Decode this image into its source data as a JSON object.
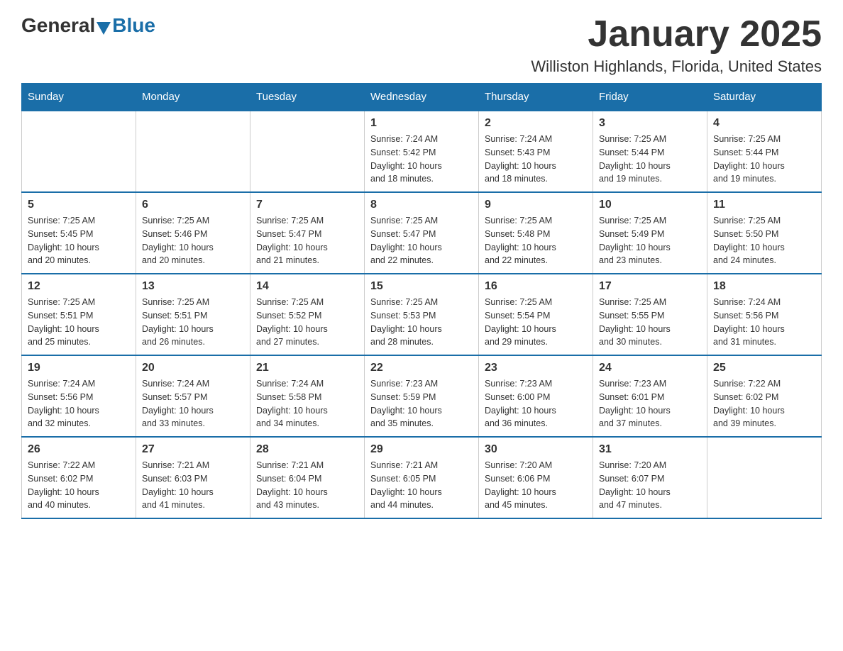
{
  "logo": {
    "general": "General",
    "blue": "Blue"
  },
  "title": "January 2025",
  "location": "Williston Highlands, Florida, United States",
  "days_of_week": [
    "Sunday",
    "Monday",
    "Tuesday",
    "Wednesday",
    "Thursday",
    "Friday",
    "Saturday"
  ],
  "weeks": [
    [
      {
        "day": "",
        "info": ""
      },
      {
        "day": "",
        "info": ""
      },
      {
        "day": "",
        "info": ""
      },
      {
        "day": "1",
        "info": "Sunrise: 7:24 AM\nSunset: 5:42 PM\nDaylight: 10 hours\nand 18 minutes."
      },
      {
        "day": "2",
        "info": "Sunrise: 7:24 AM\nSunset: 5:43 PM\nDaylight: 10 hours\nand 18 minutes."
      },
      {
        "day": "3",
        "info": "Sunrise: 7:25 AM\nSunset: 5:44 PM\nDaylight: 10 hours\nand 19 minutes."
      },
      {
        "day": "4",
        "info": "Sunrise: 7:25 AM\nSunset: 5:44 PM\nDaylight: 10 hours\nand 19 minutes."
      }
    ],
    [
      {
        "day": "5",
        "info": "Sunrise: 7:25 AM\nSunset: 5:45 PM\nDaylight: 10 hours\nand 20 minutes."
      },
      {
        "day": "6",
        "info": "Sunrise: 7:25 AM\nSunset: 5:46 PM\nDaylight: 10 hours\nand 20 minutes."
      },
      {
        "day": "7",
        "info": "Sunrise: 7:25 AM\nSunset: 5:47 PM\nDaylight: 10 hours\nand 21 minutes."
      },
      {
        "day": "8",
        "info": "Sunrise: 7:25 AM\nSunset: 5:47 PM\nDaylight: 10 hours\nand 22 minutes."
      },
      {
        "day": "9",
        "info": "Sunrise: 7:25 AM\nSunset: 5:48 PM\nDaylight: 10 hours\nand 22 minutes."
      },
      {
        "day": "10",
        "info": "Sunrise: 7:25 AM\nSunset: 5:49 PM\nDaylight: 10 hours\nand 23 minutes."
      },
      {
        "day": "11",
        "info": "Sunrise: 7:25 AM\nSunset: 5:50 PM\nDaylight: 10 hours\nand 24 minutes."
      }
    ],
    [
      {
        "day": "12",
        "info": "Sunrise: 7:25 AM\nSunset: 5:51 PM\nDaylight: 10 hours\nand 25 minutes."
      },
      {
        "day": "13",
        "info": "Sunrise: 7:25 AM\nSunset: 5:51 PM\nDaylight: 10 hours\nand 26 minutes."
      },
      {
        "day": "14",
        "info": "Sunrise: 7:25 AM\nSunset: 5:52 PM\nDaylight: 10 hours\nand 27 minutes."
      },
      {
        "day": "15",
        "info": "Sunrise: 7:25 AM\nSunset: 5:53 PM\nDaylight: 10 hours\nand 28 minutes."
      },
      {
        "day": "16",
        "info": "Sunrise: 7:25 AM\nSunset: 5:54 PM\nDaylight: 10 hours\nand 29 minutes."
      },
      {
        "day": "17",
        "info": "Sunrise: 7:25 AM\nSunset: 5:55 PM\nDaylight: 10 hours\nand 30 minutes."
      },
      {
        "day": "18",
        "info": "Sunrise: 7:24 AM\nSunset: 5:56 PM\nDaylight: 10 hours\nand 31 minutes."
      }
    ],
    [
      {
        "day": "19",
        "info": "Sunrise: 7:24 AM\nSunset: 5:56 PM\nDaylight: 10 hours\nand 32 minutes."
      },
      {
        "day": "20",
        "info": "Sunrise: 7:24 AM\nSunset: 5:57 PM\nDaylight: 10 hours\nand 33 minutes."
      },
      {
        "day": "21",
        "info": "Sunrise: 7:24 AM\nSunset: 5:58 PM\nDaylight: 10 hours\nand 34 minutes."
      },
      {
        "day": "22",
        "info": "Sunrise: 7:23 AM\nSunset: 5:59 PM\nDaylight: 10 hours\nand 35 minutes."
      },
      {
        "day": "23",
        "info": "Sunrise: 7:23 AM\nSunset: 6:00 PM\nDaylight: 10 hours\nand 36 minutes."
      },
      {
        "day": "24",
        "info": "Sunrise: 7:23 AM\nSunset: 6:01 PM\nDaylight: 10 hours\nand 37 minutes."
      },
      {
        "day": "25",
        "info": "Sunrise: 7:22 AM\nSunset: 6:02 PM\nDaylight: 10 hours\nand 39 minutes."
      }
    ],
    [
      {
        "day": "26",
        "info": "Sunrise: 7:22 AM\nSunset: 6:02 PM\nDaylight: 10 hours\nand 40 minutes."
      },
      {
        "day": "27",
        "info": "Sunrise: 7:21 AM\nSunset: 6:03 PM\nDaylight: 10 hours\nand 41 minutes."
      },
      {
        "day": "28",
        "info": "Sunrise: 7:21 AM\nSunset: 6:04 PM\nDaylight: 10 hours\nand 43 minutes."
      },
      {
        "day": "29",
        "info": "Sunrise: 7:21 AM\nSunset: 6:05 PM\nDaylight: 10 hours\nand 44 minutes."
      },
      {
        "day": "30",
        "info": "Sunrise: 7:20 AM\nSunset: 6:06 PM\nDaylight: 10 hours\nand 45 minutes."
      },
      {
        "day": "31",
        "info": "Sunrise: 7:20 AM\nSunset: 6:07 PM\nDaylight: 10 hours\nand 47 minutes."
      },
      {
        "day": "",
        "info": ""
      }
    ]
  ],
  "colors": {
    "header_bg": "#1a6ea8",
    "header_text": "#ffffff",
    "border": "#cccccc",
    "row_border": "#1a6ea8"
  }
}
